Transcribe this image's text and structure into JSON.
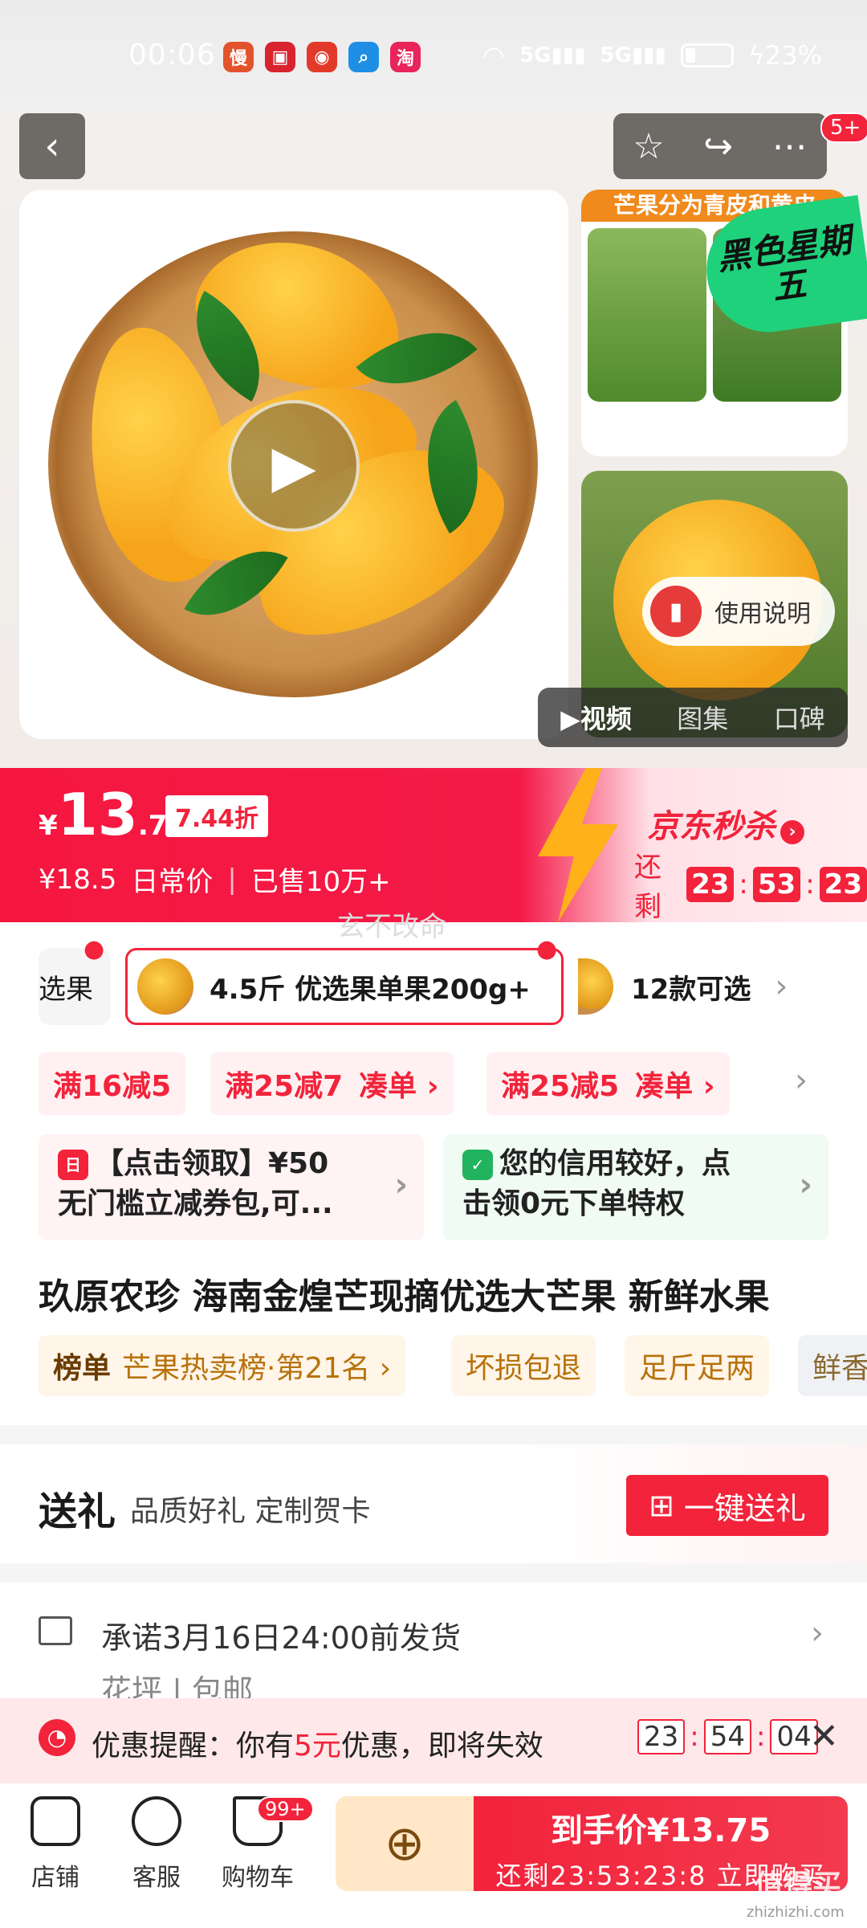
{
  "status_bar": {
    "time": "00:06",
    "apps": [
      {
        "glyph": "慢",
        "color": "#e2532d"
      },
      {
        "glyph": "▣",
        "color": "#d9232f"
      },
      {
        "glyph": "◉",
        "color": "#e23a2a"
      },
      {
        "glyph": "⌕",
        "color": "#1f8fe6"
      },
      {
        "glyph": "淘",
        "color": "#e8245b"
      }
    ],
    "net1": "5G",
    "net2": "5G",
    "battery": "23%"
  },
  "header": {
    "back_icon": "chevron-left-icon",
    "badge": "5+"
  },
  "gallery": {
    "thumb1_title": "芒果分为青皮和黄皮",
    "black_friday": "黑色星期五",
    "usage_label": "使用说明",
    "tabs": [
      "▶视频",
      "图集",
      "口碑"
    ]
  },
  "price": {
    "currency": "¥",
    "integer": "13",
    "decimal": ".75",
    "discount": "7.44折",
    "original": "¥18.5",
    "original_label": "日常价",
    "sold": "已售10万+",
    "seckill": "京东秒杀",
    "countdown_label": "还剩",
    "countdown": [
      "23",
      "53",
      "23"
    ],
    "watermark": "玄不改命"
  },
  "variants": {
    "left_partial": "选果",
    "selected": "4.5斤 优选果单果200g+",
    "more": "12款可选"
  },
  "promos": [
    {
      "text": "满16减5",
      "link": ""
    },
    {
      "text": "满25减7",
      "link": "凑单 ›"
    },
    {
      "text": "满25减5",
      "link": "凑单 ›"
    }
  ],
  "coupons": {
    "red_line1": "【点击领取】¥50",
    "red_line2": "无门槛立减券包,可...",
    "green_line1": "您的信用较好，点",
    "green_line2": "击领0元下单特权"
  },
  "product": {
    "title": "玖原农珍 海南金煌芒现摘优选大芒果 新鲜水果",
    "rank_label": "榜单",
    "rank_text": "芒果热卖榜·第21名 ›",
    "tag1": "坏损包退",
    "tag2": "足斤足两",
    "tag3": "鲜香"
  },
  "gift": {
    "title": "送礼",
    "subtitle": "品质好礼 定制贺卡",
    "button": "一键送礼"
  },
  "shipping": {
    "text": "承诺3月16日24:00前发货",
    "sub": "花坪 | 包邮"
  },
  "alert": {
    "prefix": "优惠提醒：你有",
    "amount": "5元",
    "suffix": "优惠，即将失效",
    "timer": [
      "23",
      "54",
      "04"
    ]
  },
  "bottom_nav": {
    "shop": "店铺",
    "service": "客服",
    "cart": "购物车",
    "cart_badge": "99+",
    "buy_line1": "到手价¥13.75",
    "buy_line2": "还剩23:53:23:8 立即购买",
    "site_watermark": "值得买",
    "site_url": "zhizhizhi.com"
  },
  "colors": {
    "accent": "#f2233b",
    "green": "#1fd17a"
  }
}
